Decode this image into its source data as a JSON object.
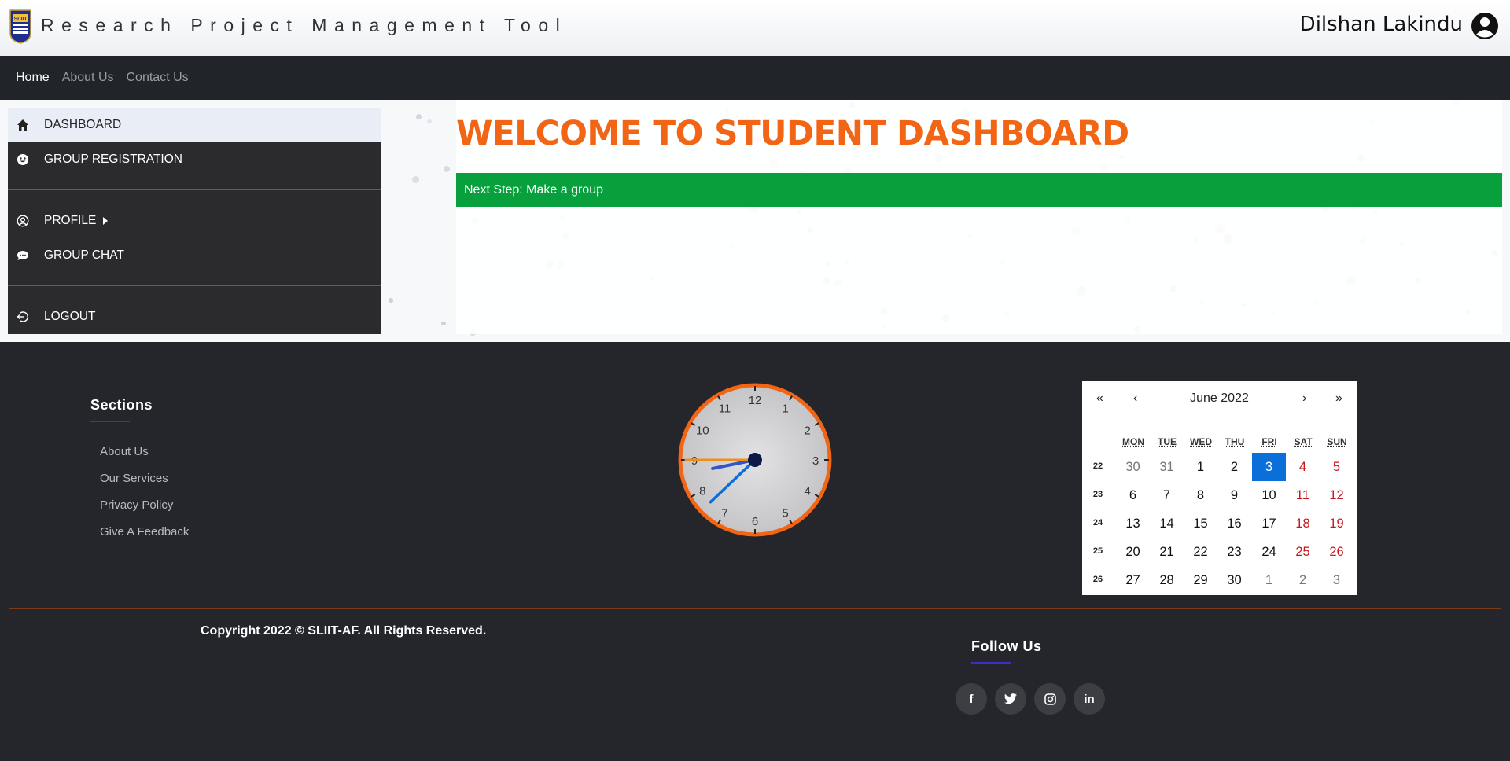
{
  "header": {
    "app_title": "Research Project Management Tool",
    "user_name": "Dilshan Lakindu",
    "logo_text": "SLIIT"
  },
  "navbar": {
    "items": [
      {
        "label": "Home",
        "active": true
      },
      {
        "label": "About Us",
        "active": false
      },
      {
        "label": "Contact Us",
        "active": false
      }
    ]
  },
  "sidebar": {
    "items": [
      {
        "label": "DASHBOARD",
        "icon": "home-icon"
      },
      {
        "label": "GROUP REGISTRATION",
        "icon": "smile-icon"
      },
      {
        "label": "PROFILE",
        "icon": "user-circle-icon"
      },
      {
        "label": "GROUP CHAT",
        "icon": "chat-icon"
      },
      {
        "label": "LOGOUT",
        "icon": "logout-icon"
      }
    ]
  },
  "main": {
    "welcome_title": "WELCOME TO STUDENT DASHBOARD",
    "next_step": "Next Step: Make a group"
  },
  "footer": {
    "sections_title": "Sections",
    "links": [
      "About Us",
      "Our Services",
      "Privacy Policy",
      "Give A Feedback"
    ],
    "copyright": "Copyright 2022 © SLIIT-AF. All Rights Reserved.",
    "follow_title": "Follow Us",
    "social": [
      {
        "icon": "facebook-icon",
        "glyph": "f"
      },
      {
        "icon": "twitter-icon",
        "glyph": "t"
      },
      {
        "icon": "instagram-icon",
        "glyph": "◎"
      },
      {
        "icon": "linkedin-icon",
        "glyph": "in"
      }
    ]
  },
  "clock": {
    "numbers": [
      "12",
      "1",
      "2",
      "3",
      "4",
      "5",
      "6",
      "7",
      "8",
      "9",
      "10",
      "11"
    ],
    "time": {
      "hour": 8,
      "minute": 37,
      "second": 45
    },
    "rim_color": "#f26515"
  },
  "calendar": {
    "nav": {
      "prev_year": "«",
      "prev_month": "‹",
      "next_month": "›",
      "next_year": "»"
    },
    "label": "June 2022",
    "weekdays": [
      "MON",
      "TUE",
      "WED",
      "THU",
      "FRI",
      "SAT",
      "SUN"
    ],
    "weeks": [
      {
        "num": "22",
        "days": [
          {
            "d": "30",
            "other": true
          },
          {
            "d": "31",
            "other": true
          },
          {
            "d": "1"
          },
          {
            "d": "2"
          },
          {
            "d": "3",
            "today": true
          },
          {
            "d": "4"
          },
          {
            "d": "5"
          }
        ]
      },
      {
        "num": "23",
        "days": [
          {
            "d": "6"
          },
          {
            "d": "7"
          },
          {
            "d": "8"
          },
          {
            "d": "9"
          },
          {
            "d": "10"
          },
          {
            "d": "11"
          },
          {
            "d": "12"
          }
        ]
      },
      {
        "num": "24",
        "days": [
          {
            "d": "13"
          },
          {
            "d": "14"
          },
          {
            "d": "15"
          },
          {
            "d": "16"
          },
          {
            "d": "17"
          },
          {
            "d": "18"
          },
          {
            "d": "19"
          }
        ]
      },
      {
        "num": "25",
        "days": [
          {
            "d": "20"
          },
          {
            "d": "21"
          },
          {
            "d": "22"
          },
          {
            "d": "23"
          },
          {
            "d": "24"
          },
          {
            "d": "25"
          },
          {
            "d": "26"
          }
        ]
      },
      {
        "num": "26",
        "days": [
          {
            "d": "27"
          },
          {
            "d": "28"
          },
          {
            "d": "29"
          },
          {
            "d": "30"
          },
          {
            "d": "1",
            "other": true
          },
          {
            "d": "2",
            "other": true
          },
          {
            "d": "3",
            "other": true
          }
        ]
      }
    ]
  },
  "colors": {
    "accent": "#f26515",
    "success": "#07a03d",
    "today": "#0a6fd9",
    "weekend": "#c9161d"
  }
}
